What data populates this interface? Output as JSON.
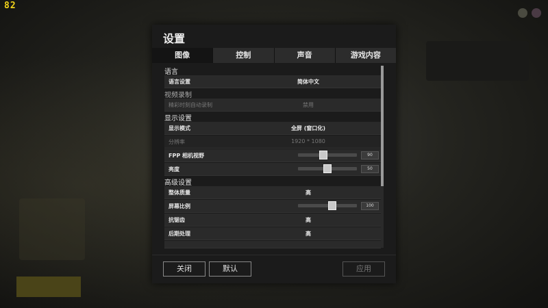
{
  "fps_counter": "82",
  "dialog": {
    "title": "设置",
    "tabs": [
      {
        "label": "图像",
        "active": true
      },
      {
        "label": "控制",
        "active": false
      },
      {
        "label": "声音",
        "active": false
      },
      {
        "label": "游戏内容",
        "active": false
      }
    ],
    "sections": {
      "language": "语言",
      "video_recording": "视频录制",
      "display": "显示设置",
      "advanced": "高级设置"
    },
    "rows": {
      "language_setting": {
        "label": "语言设置",
        "value": "简体中文"
      },
      "auto_record": {
        "label": "精彩时刻自动录制",
        "value": "禁用",
        "disabled": true
      },
      "display_mode": {
        "label": "显示模式",
        "value": "全屏 (窗口化)"
      },
      "resolution": {
        "label": "分辨率",
        "value": "1920 * 1080",
        "disabled": true
      },
      "fpp_fov": {
        "label": "FPP 相机视野",
        "value": "90",
        "slider_fraction": 0.42
      },
      "brightness": {
        "label": "亮度",
        "value": "50",
        "slider_fraction": 0.5
      },
      "overall_quality": {
        "label": "整体质量",
        "value": "高"
      },
      "screen_scale": {
        "label": "屏幕比例",
        "value": "100",
        "slider_fraction": 0.6
      },
      "anti_aliasing": {
        "label": "抗锯齿",
        "value": "高"
      },
      "post_processing": {
        "label": "后期处理",
        "value": "高"
      }
    },
    "buttons": {
      "close": "关闭",
      "default": "默认",
      "apply": "应用"
    },
    "scroll_fraction_visible": 0.66
  }
}
